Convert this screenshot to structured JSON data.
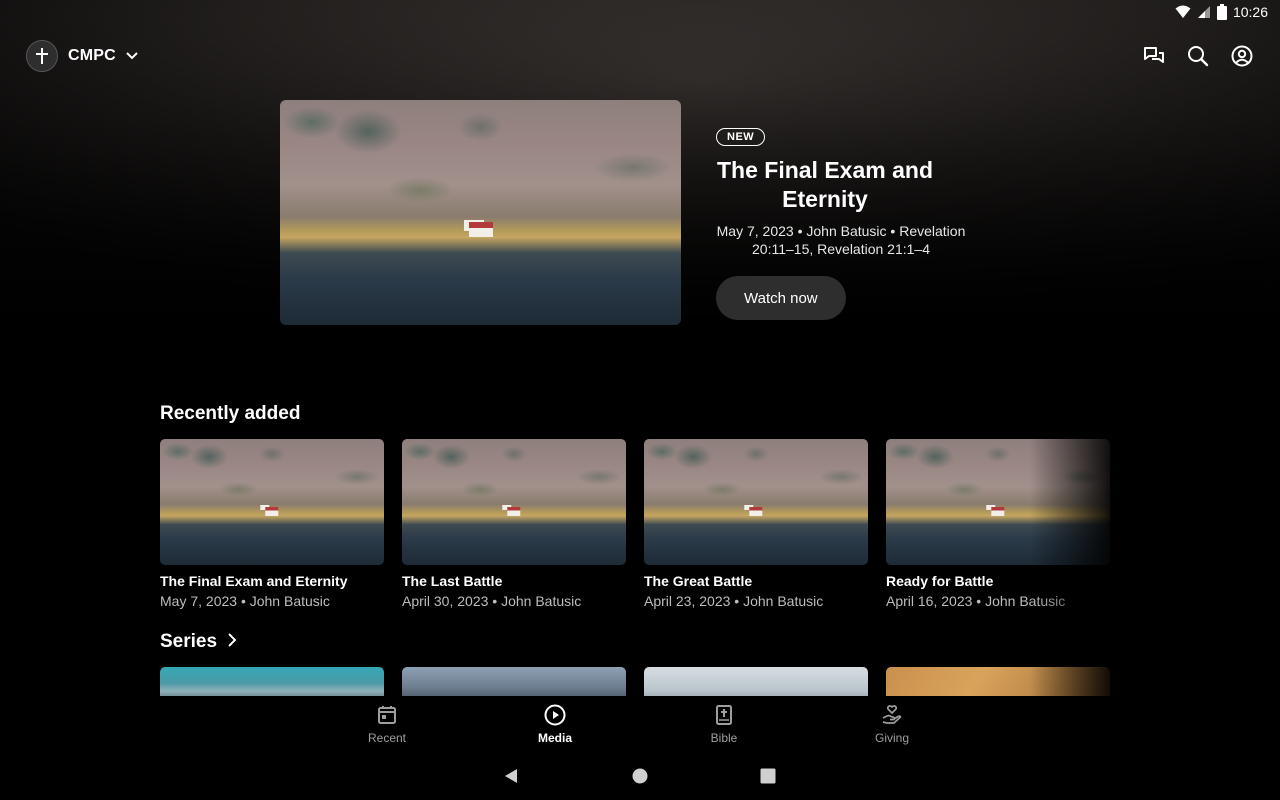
{
  "status_bar": {
    "time": "10:26"
  },
  "header": {
    "church_name": "CMPC"
  },
  "hero": {
    "badge": "NEW",
    "title": "The Final Exam and Eternity",
    "meta": "May 7, 2023 • John Batusic • Revelation 20:11–15, Revelation 21:1–4",
    "cta_label": "Watch now"
  },
  "recently_added": {
    "title": "Recently added",
    "items": [
      {
        "title": "The Final Exam and Eternity",
        "meta": "May 7, 2023 • John Batusic"
      },
      {
        "title": "The Last Battle",
        "meta": "April 30, 2023 • John Batusic"
      },
      {
        "title": "The Great Battle",
        "meta": "April 23, 2023 • John Batusic"
      },
      {
        "title": "Ready for Battle",
        "meta": "April 16, 2023 • John Batusic"
      }
    ]
  },
  "series": {
    "title": "Series"
  },
  "bottom_nav": {
    "items": [
      {
        "label": "Recent",
        "icon": "calendar-icon",
        "active": false
      },
      {
        "label": "Media",
        "icon": "play-circle-icon",
        "active": true
      },
      {
        "label": "Bible",
        "icon": "bible-icon",
        "active": false
      },
      {
        "label": "Giving",
        "icon": "giving-hand-icon",
        "active": false
      }
    ]
  }
}
